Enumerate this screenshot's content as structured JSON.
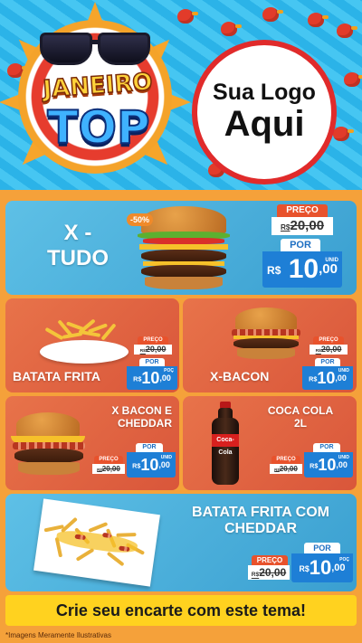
{
  "header": {
    "badge_line1": "JANEIRO",
    "badge_line2": "TOP",
    "logo_line1": "Sua Logo",
    "logo_line2": "Aqui"
  },
  "colors": {
    "pool": "#2aa9e0",
    "background": "#f5a13a",
    "card_blue": "#4fb3e0",
    "card_orange": "#e0633f",
    "price_old_label": "#e8522c",
    "price_new_value": "#1e7fd6",
    "banner": "#ffd21f",
    "logo_ring": "#e02b2b"
  },
  "products": {
    "xtudo": {
      "name_line1": "X -",
      "name_line2": "TUDO",
      "discount": "-50%",
      "preco_label": "PREÇO",
      "preco_currency": "R$",
      "preco_value": "20,00",
      "por_label": "POR",
      "por_currency": "R$",
      "por_int": "10",
      "por_cents": ",00",
      "unit": "UNID"
    },
    "batata": {
      "name": "BATATA FRITA",
      "preco_label": "PREÇO",
      "preco_currency": "R$",
      "preco_value": "20,00",
      "por_label": "POR",
      "por_currency": "R$",
      "por_int": "10",
      "por_cents": ",00",
      "unit": "POÇ"
    },
    "xbacon": {
      "name": "X-BACON",
      "preco_label": "PREÇO",
      "preco_currency": "R$",
      "preco_value": "20,00",
      "por_label": "POR",
      "por_currency": "R$",
      "por_int": "10",
      "por_cents": ",00",
      "unit": "UNID"
    },
    "xbaconcheddar": {
      "name_line1": "X BACON E",
      "name_line2": "CHEDDAR",
      "preco_label": "PREÇO",
      "preco_currency": "R$",
      "preco_value": "20,00",
      "por_label": "POR",
      "por_currency": "R$",
      "por_int": "10",
      "por_cents": ",00",
      "unit": "UNID"
    },
    "coca": {
      "name_line1": "COCA COLA",
      "name_line2": "2L",
      "label_text": "Coca-Cola",
      "preco_label": "PREÇO",
      "preco_currency": "R$",
      "preco_value": "20,00",
      "por_label": "POR",
      "por_currency": "R$",
      "por_int": "10",
      "por_cents": ",00",
      "unit": "UNID"
    },
    "batatacheddar": {
      "name_line1": "BATATA FRITA COM",
      "name_line2": "CHEDDAR",
      "preco_label": "PREÇO",
      "preco_currency": "R$",
      "preco_value": "20,00",
      "por_label": "POR",
      "por_currency": "R$",
      "por_int": "10",
      "por_cents": ",00",
      "unit": "POÇ"
    }
  },
  "footer": {
    "banner_text": "Crie seu encarte com este tema!",
    "note": "*Imagens Meramente Ilustrativas"
  }
}
